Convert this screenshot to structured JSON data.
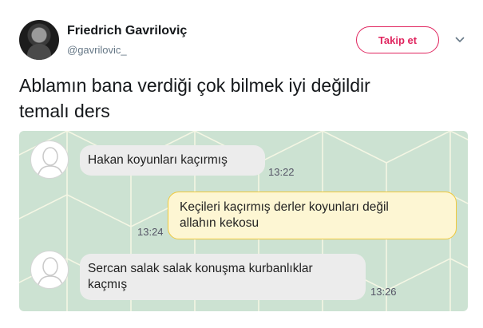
{
  "author": {
    "display_name": "Friedrich Gavriloviç",
    "handle": "@gavrilovic_"
  },
  "actions": {
    "follow_label": "Takip et",
    "more_icon": "chevron-down-icon"
  },
  "tweet": {
    "text_line1": "Ablamın bana verdiği çok bilmek iyi değildir",
    "text_line2": "temalı ders"
  },
  "chat": {
    "messages": [
      {
        "direction": "incoming",
        "text": "Hakan koyunları kaçırmış",
        "time": "13:22"
      },
      {
        "direction": "outgoing",
        "line1": "Keçileri kaçırmış derler koyunları değil",
        "line2": "allahın kekosu",
        "time": "13:24"
      },
      {
        "direction": "incoming",
        "line1": "Sercan salak salak konuşma kurbanlıklar",
        "line2": "kaçmış",
        "time": "13:26"
      }
    ]
  },
  "colors": {
    "follow_accent": "#e0245e",
    "chat_background": "#cce2d2",
    "pattern_line": "#f4f6e4",
    "incoming_bubble": "#ececec",
    "outgoing_bubble": "#fdf6d3",
    "outgoing_border": "#f0c93a"
  }
}
